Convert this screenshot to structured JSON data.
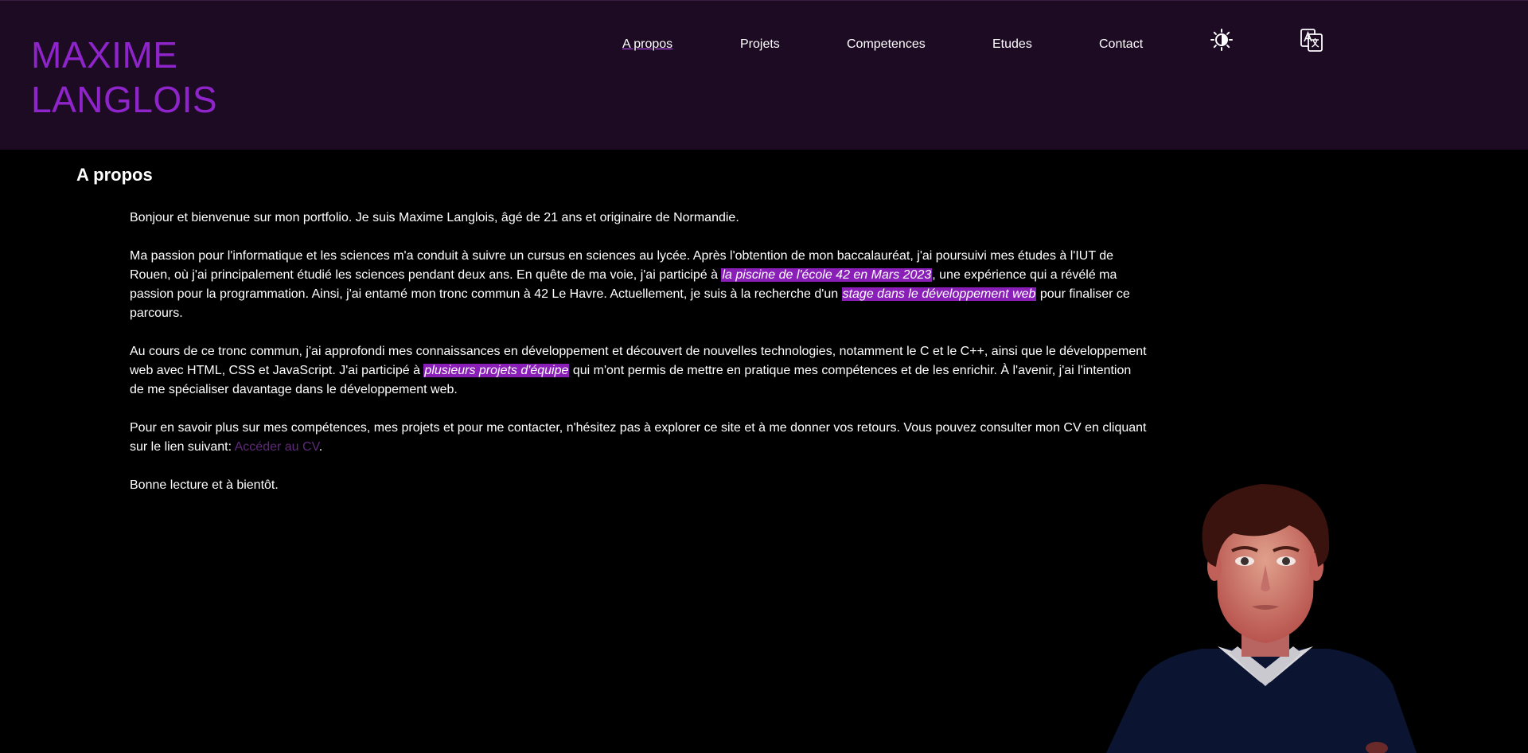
{
  "header": {
    "logo_line1": "MAXIME",
    "logo_line2": "LANGLOIS",
    "nav": [
      {
        "label": "A propos",
        "active": true
      },
      {
        "label": "Projets",
        "active": false
      },
      {
        "label": "Competences",
        "active": false
      },
      {
        "label": "Etudes",
        "active": false
      },
      {
        "label": "Contact",
        "active": false
      }
    ],
    "theme_icon": "contrast-icon",
    "language_icon": "translate-icon"
  },
  "main": {
    "title": "A propos",
    "p1": "Bonjour et bienvenue sur mon portfolio. Je suis Maxime Langlois, âgé de 21 ans et originaire de Normandie.",
    "p2_a": "Ma passion pour l'informatique et les sciences m'a conduit à suivre un cursus en sciences au lycée. Après l'obtention de mon baccalauréat, j'ai poursuivi mes études à l'IUT de Rouen, où j'ai principalement étudié les sciences pendant deux ans. En quête de ma voie, j'ai participé à ",
    "p2_hl1": "la piscine de l'école 42 en Mars 2023",
    "p2_b": ", une expérience qui a révélé ma passion pour la programmation. Ainsi, j'ai entamé mon tronc commun à 42 Le Havre. Actuellement, je suis à la recherche d'un ",
    "p2_hl2": "stage dans le développement web",
    "p2_c": " pour finaliser ce parcours.",
    "p3_a": "Au cours de ce tronc commun, j'ai approfondi mes connaissances en développement et découvert de nouvelles technologies, notamment le C et le C++, ainsi que le développement web avec HTML, CSS et JavaScript. J'ai participé à ",
    "p3_hl": "plusieurs projets d'équipe",
    "p3_b": " qui m'ont permis de mettre en pratique mes compétences et de les enrichir. À l'avenir, j'ai l'intention de me spécialiser davantage dans le développement web.",
    "p4_a": "Pour en savoir plus sur mes compétences, mes projets et pour me contacter, n'hésitez pas à explorer ce site et à me donner vos retours. Vous pouvez consulter mon CV en cliquant sur le lien suivant: ",
    "p4_link": "Accéder au CV",
    "p4_b": ".",
    "p5": "Bonne lecture et à bientôt."
  },
  "colors": {
    "header_bg": "#1d0b24",
    "accent": "#8e24c9",
    "highlight": "#8a1fb8",
    "link": "#5e2a7a"
  }
}
